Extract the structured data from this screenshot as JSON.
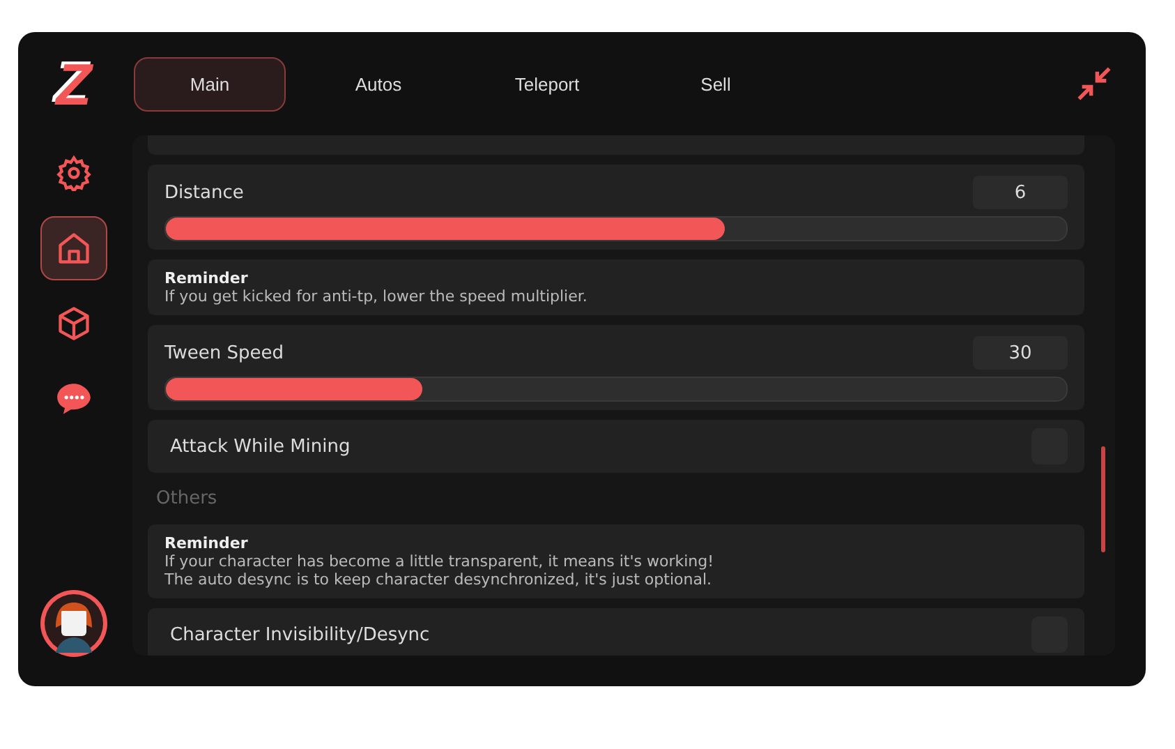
{
  "logo": "Z",
  "sidebar": {
    "items": [
      {
        "kind": "settings",
        "selected": false
      },
      {
        "kind": "home",
        "selected": true
      },
      {
        "kind": "box",
        "selected": false
      },
      {
        "kind": "chat",
        "selected": false
      }
    ]
  },
  "tabs": [
    {
      "label": "Main",
      "selected": true
    },
    {
      "label": "Autos",
      "selected": false
    },
    {
      "label": "Teleport",
      "selected": false
    },
    {
      "label": "Sell",
      "selected": false
    }
  ],
  "items": [
    {
      "kind": "partial"
    },
    {
      "kind": "slider",
      "label": "Distance",
      "value": "6",
      "level": 0.62
    },
    {
      "kind": "reminder",
      "title": "Reminder",
      "lines": [
        "If you get kicked for anti-tp, lower the speed multiplier."
      ]
    },
    {
      "kind": "slider",
      "label": "Tween Speed",
      "value": "30",
      "level": 0.285
    },
    {
      "kind": "toggle",
      "label": "Attack While Mining",
      "on": false
    },
    {
      "kind": "section",
      "label": "Others"
    },
    {
      "kind": "reminder",
      "title": "Reminder",
      "lines": [
        "If your character has become a little transparent, it means it's working!",
        "The auto desync is to keep character desynchronized, it's just optional."
      ]
    },
    {
      "kind": "toggle",
      "label": "Character Invisibility/Desync",
      "on": false
    }
  ]
}
